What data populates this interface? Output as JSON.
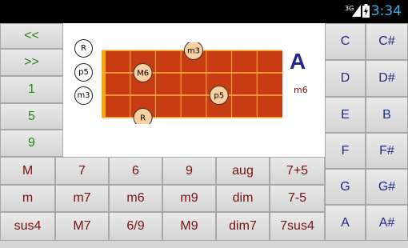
{
  "status_bar": {
    "network": "3G",
    "time": "3:34"
  },
  "nav": {
    "prev": "<<",
    "next": ">>"
  },
  "positions": [
    "1",
    "5",
    "9"
  ],
  "chord_types": [
    [
      "M",
      "7",
      "6",
      "9",
      "aug",
      "7+5"
    ],
    [
      "m",
      "m7",
      "m6",
      "m9",
      "dim",
      "7-5"
    ],
    [
      "sus4",
      "M7",
      "6/9",
      "M9",
      "dim7",
      "7sus4"
    ]
  ],
  "notes": [
    [
      "C",
      "C#"
    ],
    [
      "D",
      "D#"
    ],
    [
      "E",
      "B"
    ],
    [
      "F",
      "F#"
    ],
    [
      "G",
      "G#"
    ],
    [
      "A",
      "A#"
    ]
  ],
  "display": {
    "root": "A",
    "quality": "m6",
    "legend": [
      "R",
      "p5",
      "m3"
    ],
    "dots": [
      {
        "label": "m3",
        "string": 1,
        "fret": 4
      },
      {
        "label": "M6",
        "string": 2,
        "fret": 2
      },
      {
        "label": "p5",
        "string": 3,
        "fret": 5
      },
      {
        "label": "R",
        "string": 4,
        "fret": 2
      }
    ]
  },
  "colors": {
    "fretboard": "#c83c14",
    "nut": "#ffa500",
    "dot": "#fbd0a0",
    "time": "#33b5e5"
  }
}
